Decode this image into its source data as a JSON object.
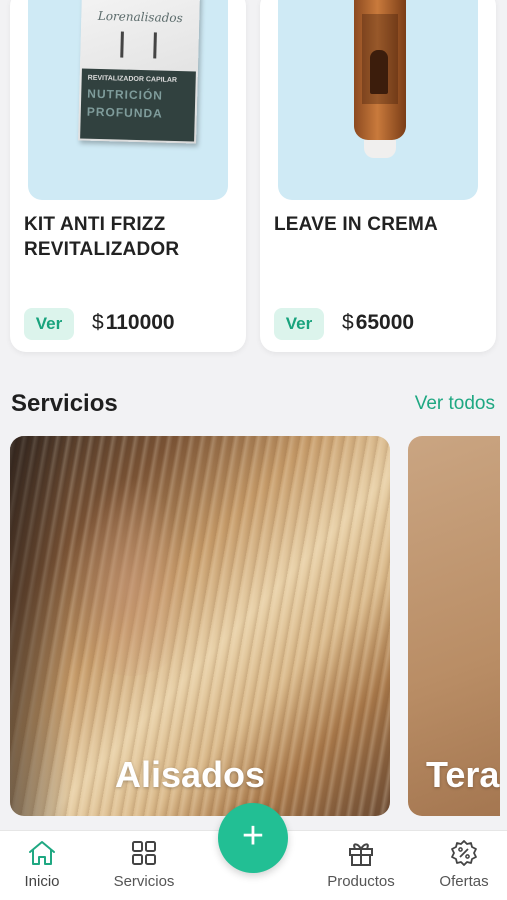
{
  "products": [
    {
      "title": "KIT ANTI FRIZZ REVITALIZADOR",
      "button": "Ver",
      "currency": "$",
      "price": "110000",
      "image": {
        "brand": "Lorenalisados",
        "line1": "REVITALIZADOR CAPILAR",
        "line2": "NUTRICIÓN",
        "line3": "PROFUNDA"
      }
    },
    {
      "title": "LEAVE IN CREMA",
      "button": "Ver",
      "currency": "$",
      "price": "65000"
    }
  ],
  "services_section": {
    "title": "Servicios",
    "see_all": "Ver todos",
    "items": [
      {
        "label": "Alisados"
      },
      {
        "label": "Tera"
      }
    ]
  },
  "nav": {
    "items": [
      {
        "label": "Inicio",
        "icon": "home-icon",
        "active": true
      },
      {
        "label": "Servicios",
        "icon": "grid-icon"
      },
      {
        "label": "Productos",
        "icon": "gift-icon"
      },
      {
        "label": "Ofertas",
        "icon": "discount-icon"
      }
    ],
    "fab_icon": "plus-icon",
    "accent": "#22bf94",
    "active_color": "#1fa882"
  }
}
